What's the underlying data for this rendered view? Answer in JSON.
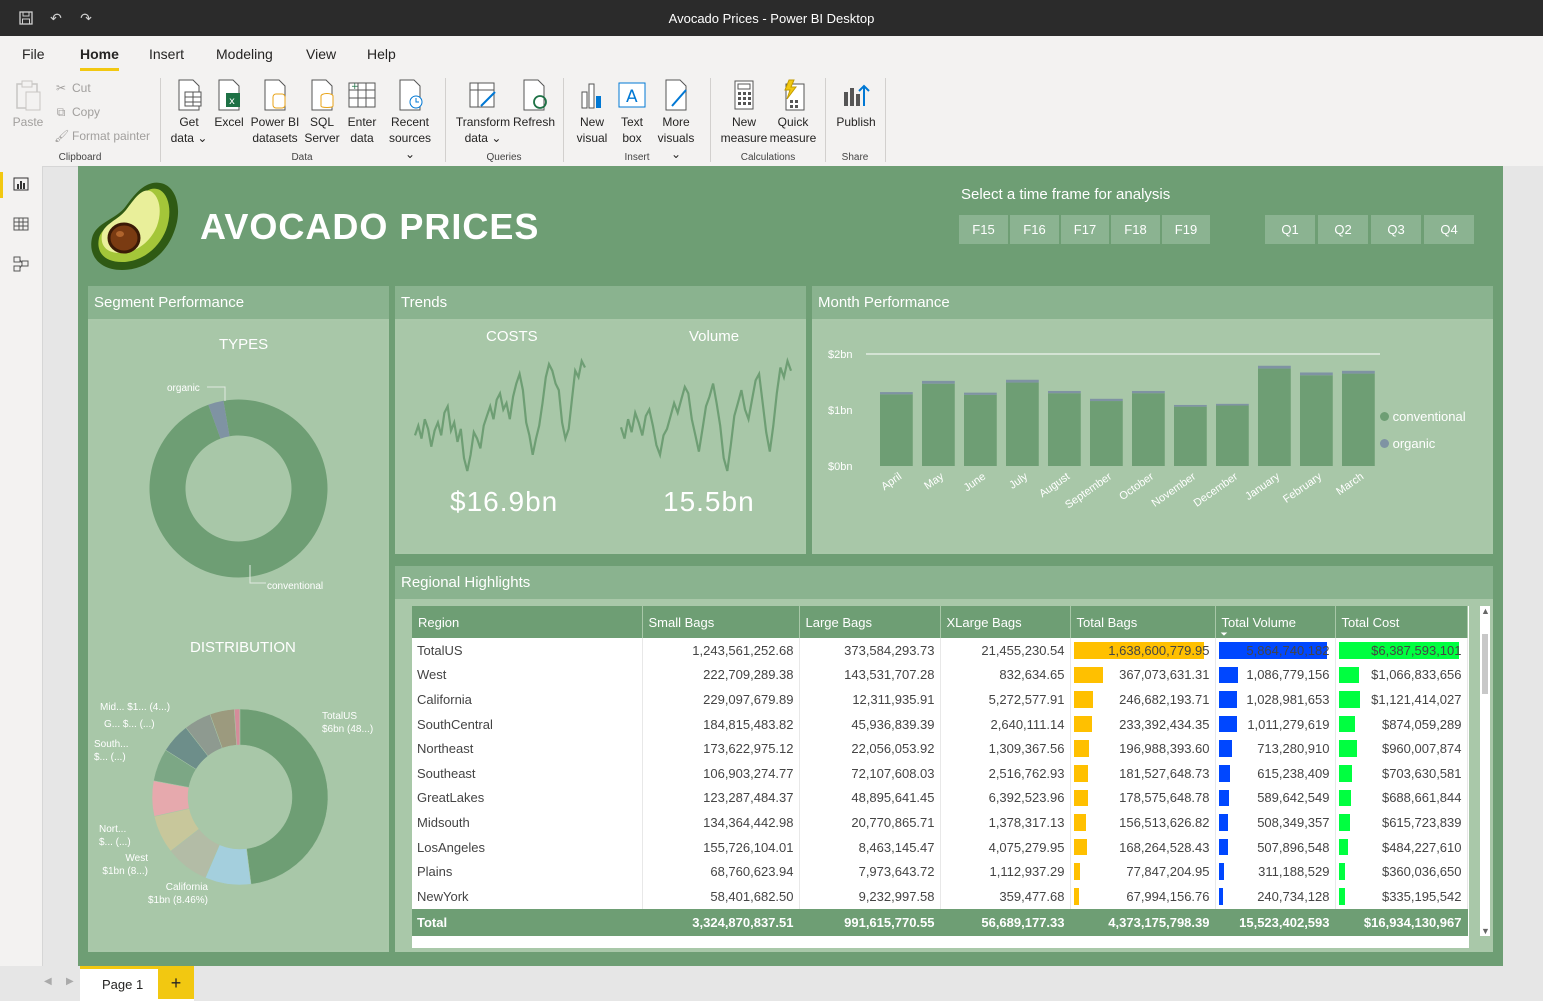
{
  "app": {
    "window_title": "Avocado Prices - Power BI Desktop"
  },
  "ribbon": {
    "tabs": [
      "File",
      "Home",
      "Insert",
      "Modeling",
      "View",
      "Help"
    ],
    "clipboard": {
      "paste": "Paste",
      "cut": "Cut",
      "copy": "Copy",
      "format_painter": "Format painter",
      "group": "Clipboard"
    },
    "data": {
      "get_data": [
        "Get",
        "data ⌄"
      ],
      "excel": [
        "Excel",
        ""
      ],
      "pbi_datasets": [
        "Power BI",
        "datasets"
      ],
      "sql": [
        "SQL",
        "Server"
      ],
      "enter": [
        "Enter",
        "data"
      ],
      "recent": [
        "Recent",
        "sources ⌄"
      ],
      "group": "Data"
    },
    "queries": {
      "transform": [
        "Transform",
        "data ⌄"
      ],
      "refresh": [
        "Refresh",
        ""
      ],
      "group": "Queries"
    },
    "insert": {
      "new_visual": [
        "New",
        "visual"
      ],
      "text_box": [
        "Text",
        "box"
      ],
      "more_visuals": [
        "More",
        "visuals ⌄"
      ],
      "group": "Insert"
    },
    "calculations": {
      "new_measure": [
        "New",
        "measure"
      ],
      "quick_measure": [
        "Quick",
        "measure"
      ],
      "group": "Calculations"
    },
    "share": {
      "publish": [
        "Publish",
        ""
      ],
      "group": "Share"
    }
  },
  "report": {
    "title": "AVOCADO PRICES",
    "timeframe_prompt": "Select a time frame for analysis",
    "years": [
      "F15",
      "F16",
      "F17",
      "F18",
      "F19"
    ],
    "quarters": [
      "Q1",
      "Q2",
      "Q3",
      "Q4"
    ],
    "segment": {
      "header": "Segment Performance",
      "types_title": "TYPES",
      "types_labels": {
        "organic": "organic",
        "conventional": "conventional"
      },
      "types_share": {
        "conventional": 0.972,
        "organic": 0.028
      },
      "distribution_title": "DISTRIBUTION",
      "distribution_labels": {
        "totalus": [
          "TotalUS",
          "$6bn (48...)"
        ],
        "mid": "Mid... $1... (4...)",
        "g": "G... $... (...)",
        "south": [
          "South...",
          "$... (...)"
        ],
        "nort": [
          "Nort...",
          "$... (...)"
        ],
        "west": [
          "West",
          "$1bn (8...)"
        ],
        "california": [
          "California",
          "$1bn (8.46%)"
        ]
      },
      "distribution_share": [
        0.48,
        0.0846,
        0.08,
        0.07,
        0.065,
        0.06,
        0.055,
        0.05,
        0.045,
        0.01
      ]
    },
    "trends": {
      "header": "Trends",
      "costs_title": "COSTS",
      "costs_value": "$16.9bn",
      "volume_title": "Volume",
      "volume_value": "15.5bn"
    },
    "month": {
      "header": "Month Performance",
      "legend": [
        "conventional",
        "organic"
      ]
    },
    "regional": {
      "header": "Regional Highlights",
      "columns": [
        "Region",
        "Small Bags",
        "Large Bags",
        "XLarge Bags",
        "Total Bags",
        "Total Volume",
        "Total Cost"
      ],
      "sort_indicator": "⏷",
      "rows": [
        [
          "TotalUS",
          "1,243,561,252.68",
          "373,584,293.73",
          "21,455,230.54",
          "1,638,600,779.95",
          "5,864,740,182",
          "$6,387,593,101"
        ],
        [
          "West",
          "222,709,289.38",
          "143,531,707.28",
          "832,634.65",
          "367,073,631.31",
          "1,086,779,156",
          "$1,066,833,656"
        ],
        [
          "California",
          "229,097,679.89",
          "12,311,935.91",
          "5,272,577.91",
          "246,682,193.71",
          "1,028,981,653",
          "$1,121,414,027"
        ],
        [
          "SouthCentral",
          "184,815,483.82",
          "45,936,839.39",
          "2,640,111.14",
          "233,392,434.35",
          "1,011,279,619",
          "$874,059,289"
        ],
        [
          "Northeast",
          "173,622,975.12",
          "22,056,053.92",
          "1,309,367.56",
          "196,988,393.60",
          "713,280,910",
          "$960,007,874"
        ],
        [
          "Southeast",
          "106,903,274.77",
          "72,107,608.03",
          "2,516,762.93",
          "181,527,648.73",
          "615,238,409",
          "$703,630,581"
        ],
        [
          "GreatLakes",
          "123,287,484.37",
          "48,895,641.45",
          "6,392,523.96",
          "178,575,648.78",
          "589,642,549",
          "$688,661,844"
        ],
        [
          "Midsouth",
          "134,364,442.98",
          "20,770,865.71",
          "1,378,317.13",
          "156,513,626.82",
          "508,349,357",
          "$615,723,839"
        ],
        [
          "LosAngeles",
          "155,726,104.01",
          "8,463,145.47",
          "4,075,279.95",
          "168,264,528.43",
          "507,896,548",
          "$484,227,610"
        ],
        [
          "Plains",
          "68,760,623.94",
          "7,973,643.72",
          "1,112,937.29",
          "77,847,204.95",
          "311,188,529",
          "$360,036,650"
        ],
        [
          "NewYork",
          "58,401,682.50",
          "9,232,997.58",
          "359,477.68",
          "67,994,156.76",
          "240,734,128",
          "$335,195,542"
        ]
      ],
      "totals": [
        "Total",
        "3,324,870,837.51",
        "991,615,770.55",
        "56,689,177.33",
        "4,373,175,798.39",
        "15,523,402,593",
        "$16,934,130,967"
      ],
      "bar_fractions": {
        "total_bags": [
          1.0,
          0.224,
          0.151,
          0.142,
          0.12,
          0.111,
          0.109,
          0.096,
          0.103,
          0.048,
          0.041
        ],
        "total_volume": [
          1.0,
          0.185,
          0.175,
          0.172,
          0.122,
          0.105,
          0.101,
          0.087,
          0.087,
          0.053,
          0.041
        ],
        "total_cost": [
          1.0,
          0.167,
          0.176,
          0.137,
          0.15,
          0.11,
          0.108,
          0.096,
          0.076,
          0.056,
          0.052
        ]
      },
      "bar_colors": {
        "total_bags": "#ffc000",
        "total_volume": "#0047ff",
        "total_cost": "#00ff40"
      }
    }
  },
  "chart_data": [
    {
      "type": "bar",
      "title": "Month Performance",
      "categories": [
        "April",
        "May",
        "June",
        "July",
        "August",
        "September",
        "October",
        "November",
        "December",
        "January",
        "February",
        "March"
      ],
      "series": [
        {
          "name": "conventional",
          "values": [
            1.28,
            1.47,
            1.27,
            1.49,
            1.3,
            1.16,
            1.3,
            1.06,
            1.08,
            1.74,
            1.62,
            1.65
          ]
        },
        {
          "name": "organic",
          "values": [
            0.04,
            0.05,
            0.04,
            0.05,
            0.04,
            0.04,
            0.04,
            0.03,
            0.03,
            0.05,
            0.05,
            0.05
          ]
        }
      ],
      "yticks": [
        "$2bn",
        "$1bn",
        "$0bn"
      ],
      "ylim": [
        0,
        2
      ],
      "stacked": true,
      "legend": "right"
    },
    {
      "type": "line",
      "title": "COSTS",
      "values": [
        52,
        58,
        50,
        62,
        56,
        45,
        55,
        60,
        52,
        66,
        70,
        55,
        60,
        48,
        56,
        38,
        30,
        40,
        54,
        50,
        44,
        58,
        64,
        70,
        62,
        74,
        78,
        68,
        72,
        62,
        76,
        84,
        90,
        80,
        60,
        52,
        40,
        50,
        58,
        72,
        88,
        96,
        92,
        84,
        80,
        60,
        50,
        56,
        74,
        92,
        88,
        98,
        94
      ]
    },
    {
      "type": "line",
      "title": "Volume",
      "values": [
        55,
        48,
        60,
        52,
        64,
        58,
        50,
        62,
        66,
        56,
        44,
        38,
        50,
        54,
        62,
        70,
        64,
        72,
        80,
        76,
        60,
        50,
        40,
        54,
        68,
        74,
        82,
        70,
        56,
        36,
        28,
        44,
        62,
        70,
        78,
        66,
        60,
        72,
        84,
        88,
        70,
        52,
        40,
        56,
        76,
        92,
        86,
        96,
        90
      ]
    }
  ]
}
